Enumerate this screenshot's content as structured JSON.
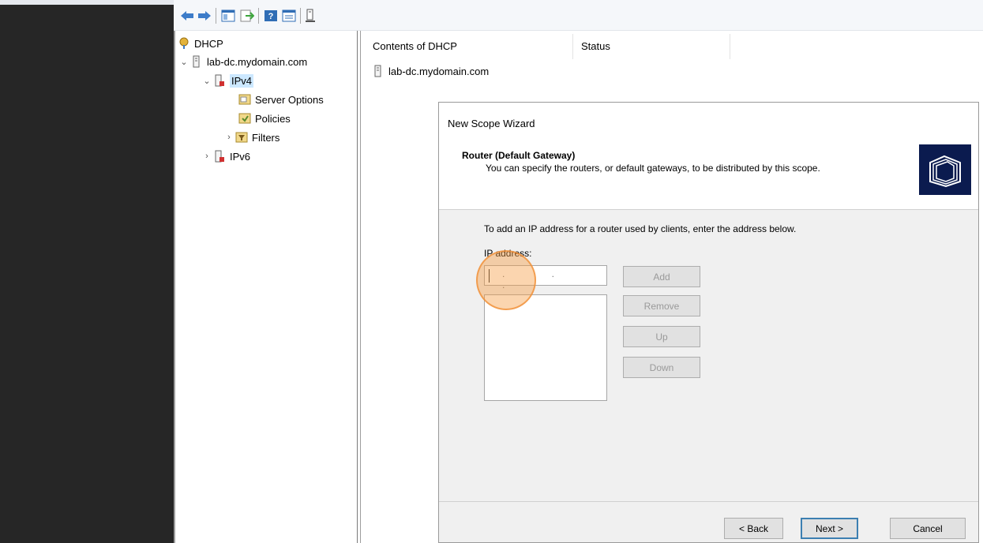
{
  "toolbar": {
    "icons": [
      "back-arrow-icon",
      "forward-arrow-icon",
      "show-hide-tree-icon",
      "export-list-icon",
      "help-icon",
      "properties-icon",
      "server-icon"
    ]
  },
  "tree": {
    "root_label": "DHCP",
    "server_label": "lab-dc.mydomain.com",
    "ipv4_label": "IPv4",
    "server_options_label": "Server Options",
    "policies_label": "Policies",
    "filters_label": "Filters",
    "ipv6_label": "IPv6"
  },
  "content": {
    "col_contents": "Contents of DHCP",
    "col_status": "Status",
    "items": [
      "lab-dc.mydomain.com"
    ]
  },
  "wizard": {
    "title": "New Scope Wizard",
    "heading": "Router (Default Gateway)",
    "subheading": "You can specify the routers, or default gateways, to be distributed by this scope.",
    "instruction": "To add an IP address for a router used by clients, enter the address below.",
    "ip_label": "IP address:",
    "ip_value": ". . .",
    "buttons": {
      "add": "Add",
      "remove": "Remove",
      "up": "Up",
      "down": "Down",
      "back": "< Back",
      "next": "Next >",
      "cancel": "Cancel"
    }
  },
  "colors": {
    "selection": "#cce8ff",
    "wizard_logo_bg": "#0b1b4f",
    "focus_highlight": "#f69a40",
    "dark_sidebar": "#262626"
  }
}
